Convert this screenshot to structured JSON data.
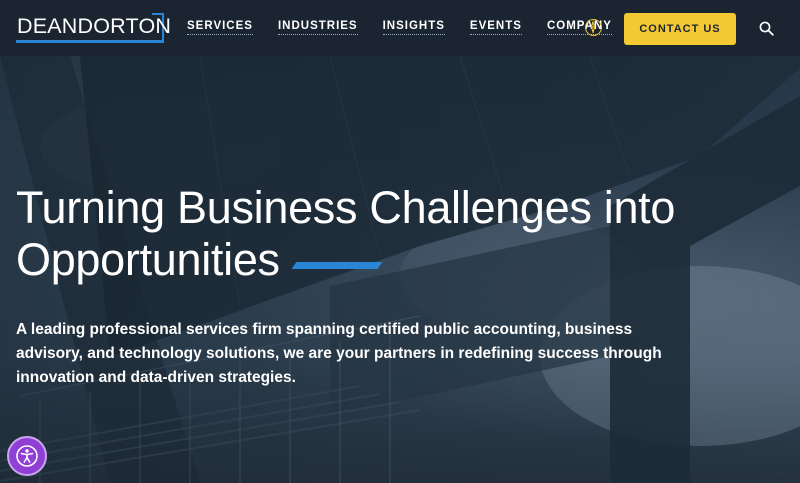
{
  "logo": {
    "text": "DEANDORTON"
  },
  "nav": {
    "items": [
      "SERVICES",
      "INDUSTRIES",
      "INSIGHTS",
      "EVENTS",
      "COMPANY"
    ]
  },
  "header": {
    "contact_label": "CONTACT US"
  },
  "icons": {
    "compass": "compass-icon",
    "search": "search-icon",
    "accessibility": "accessibility-icon"
  },
  "hero": {
    "headline_line1": "Turning Business Challenges into",
    "headline_line2": "Opportunities",
    "subtext": "A leading professional services firm spanning certified public accounting, business advisory, and technology solutions, we are your partners in redefining success through innovation and data-driven strategies."
  },
  "colors": {
    "header_bg": "#1a2531",
    "accent_blue": "#2a85d4",
    "cta_yellow": "#f5c932",
    "a11y_purple": "#8f3fd4"
  }
}
